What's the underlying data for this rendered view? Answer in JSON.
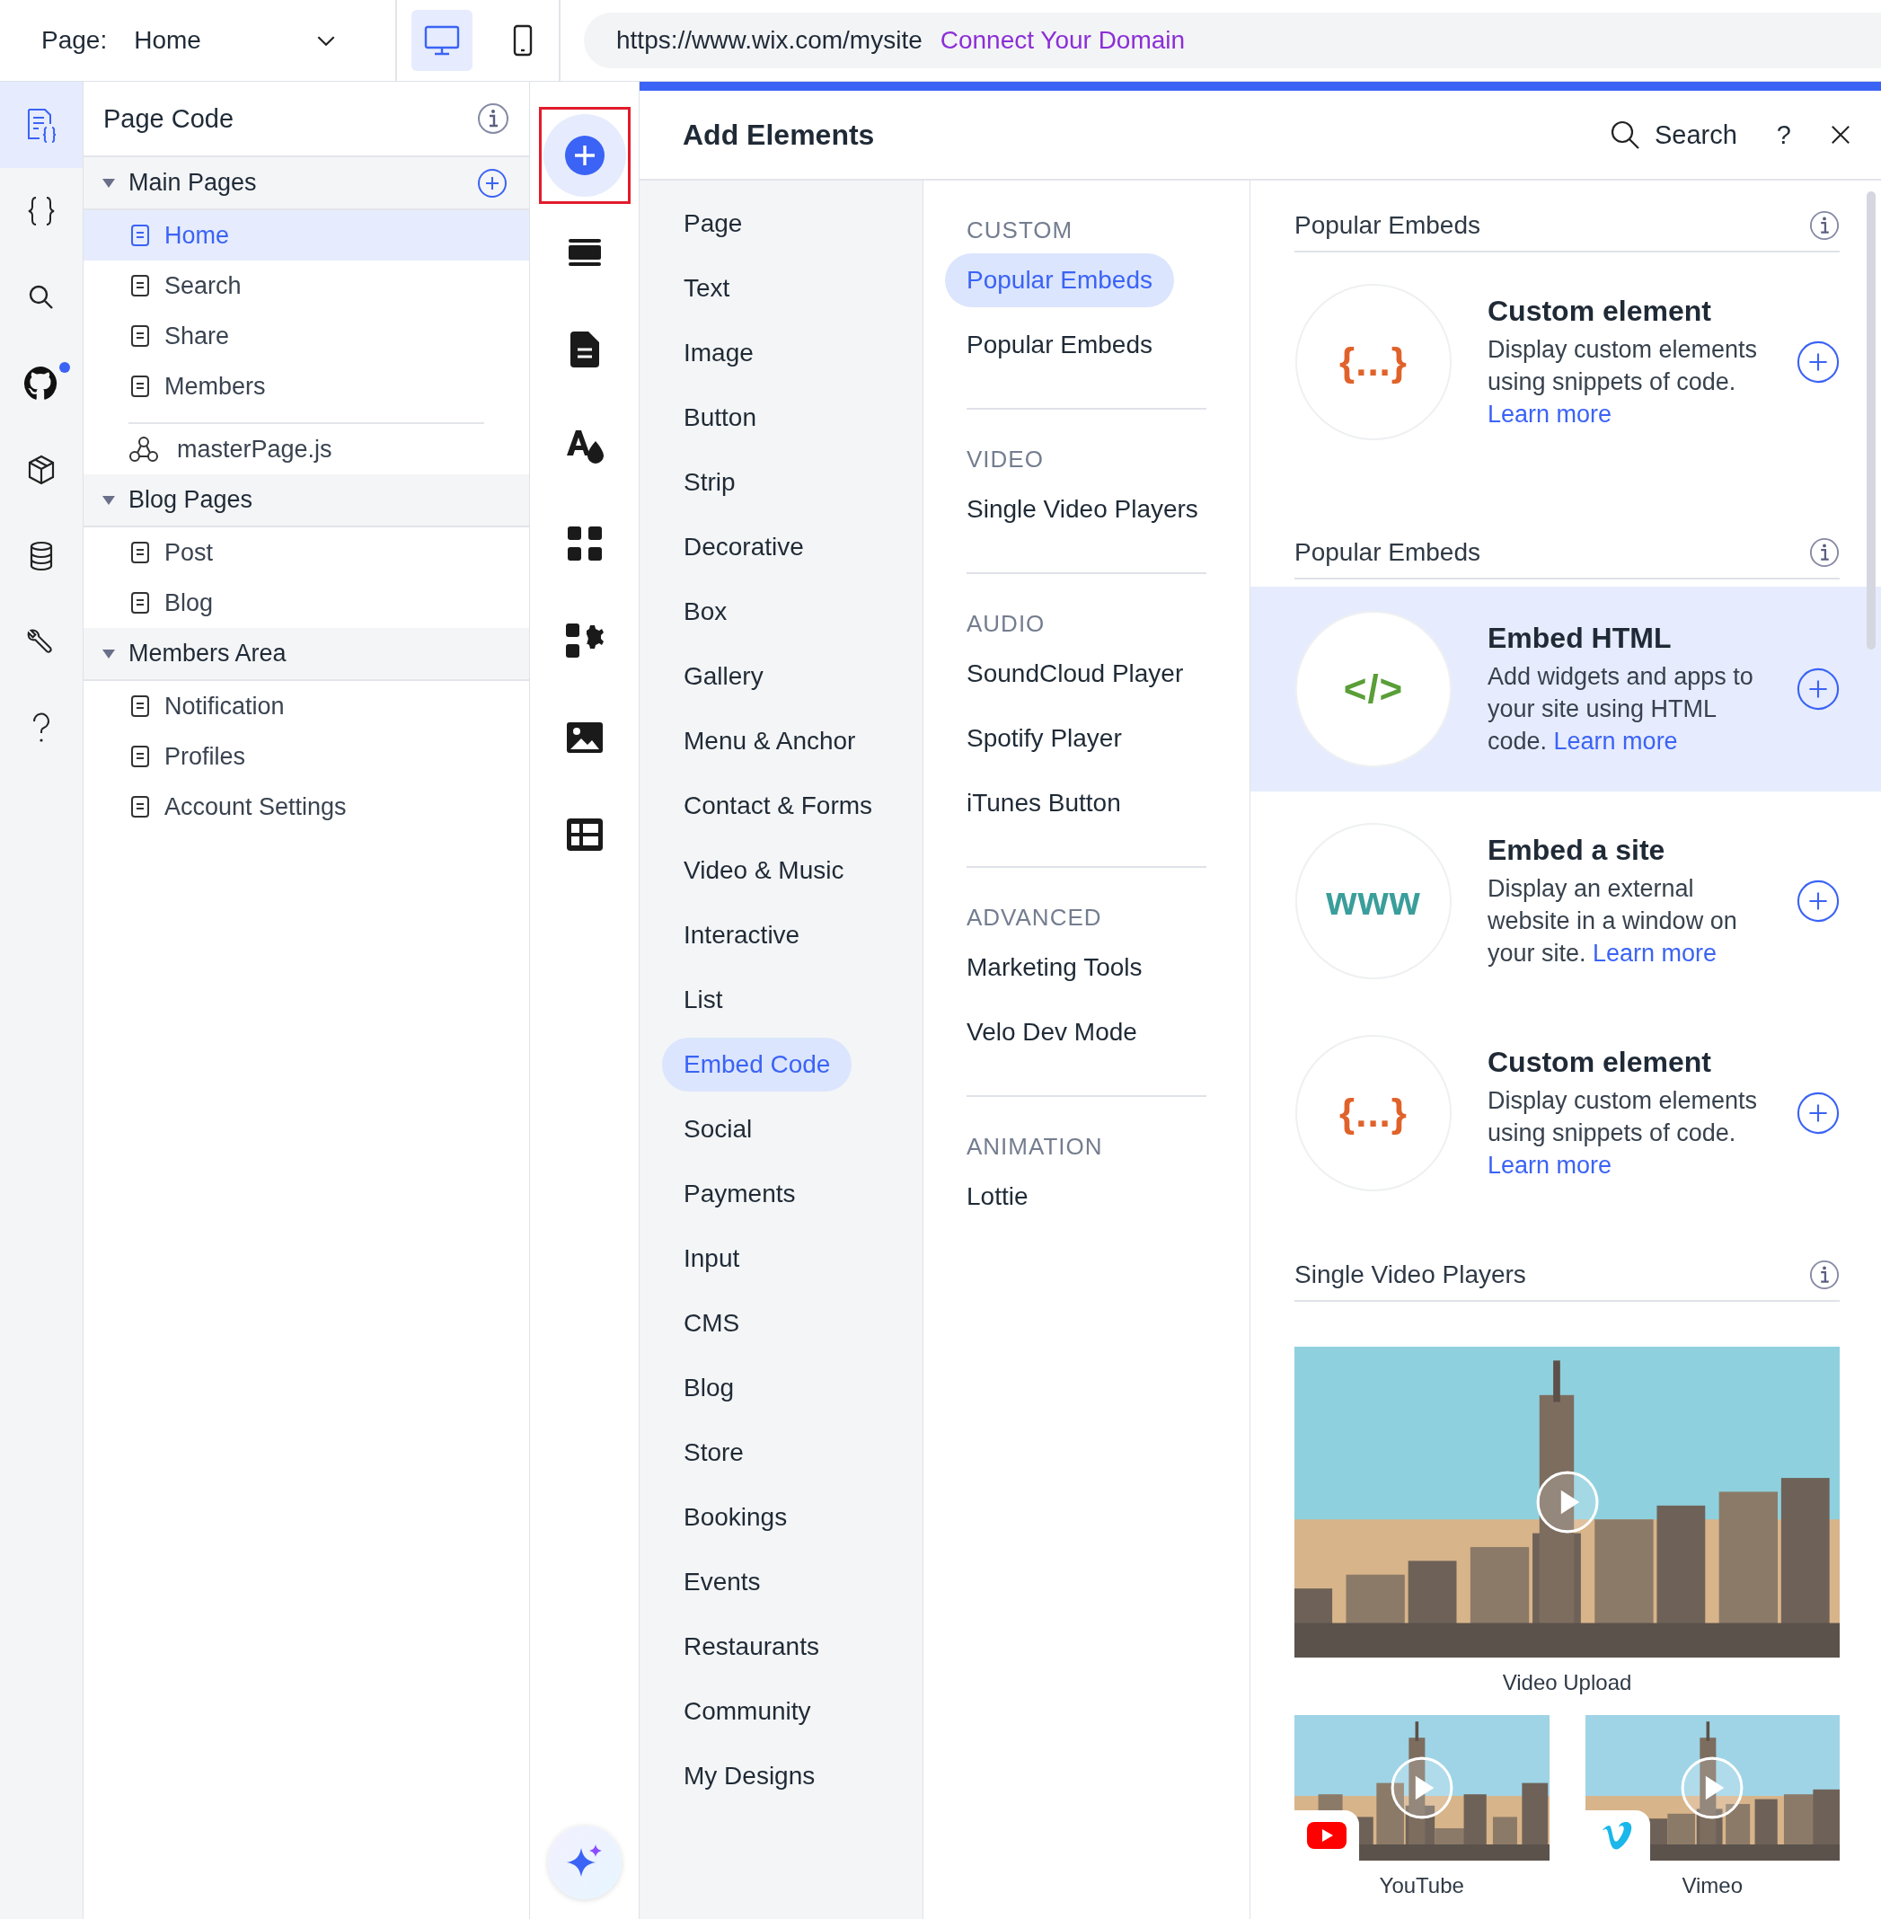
{
  "top_bar": {
    "page_label": "Page:",
    "page_value": "Home",
    "views": [
      {
        "kind": "desktop",
        "selected": true
      },
      {
        "kind": "mobile",
        "selected": false
      }
    ],
    "url": "https://www.wix.com/mysite",
    "domain_link": "Connect Your Domain"
  },
  "icon_rail": [
    {
      "kind": "page-code",
      "selected": true,
      "badge": false
    },
    {
      "kind": "braces",
      "selected": false,
      "badge": false
    },
    {
      "kind": "search",
      "selected": false,
      "badge": false
    },
    {
      "kind": "cat",
      "selected": false,
      "badge": true
    },
    {
      "kind": "cube",
      "selected": false,
      "badge": false
    },
    {
      "kind": "database",
      "selected": false,
      "badge": false
    },
    {
      "kind": "wrench",
      "selected": false,
      "badge": false
    },
    {
      "kind": "help",
      "selected": false,
      "badge": false
    }
  ],
  "page_code": {
    "title": "Page Code",
    "groups": [
      {
        "label": "Main Pages",
        "expanded": true,
        "add_button": true,
        "children": [
          {
            "label": "Home",
            "kind": "page",
            "selected": true
          },
          {
            "label": "Search",
            "kind": "page",
            "selected": false
          },
          {
            "label": "Share",
            "kind": "page",
            "selected": false
          },
          {
            "label": "Members",
            "kind": "page",
            "selected": false
          },
          {
            "label": "masterPage.js",
            "kind": "master",
            "selected": false
          }
        ]
      },
      {
        "label": "Blog Pages",
        "expanded": true,
        "add_button": false,
        "children": [
          {
            "label": "Post",
            "kind": "page",
            "selected": false
          },
          {
            "label": "Blog",
            "kind": "page",
            "selected": false
          }
        ]
      },
      {
        "label": "Members Area",
        "expanded": true,
        "add_button": false,
        "children": [
          {
            "label": "Notification",
            "kind": "page",
            "selected": false
          },
          {
            "label": "Profiles",
            "kind": "page",
            "selected": false
          },
          {
            "label": "Account Settings",
            "kind": "page",
            "selected": false
          }
        ]
      }
    ]
  },
  "tool_rail": [
    {
      "kind": "add",
      "selected": true
    },
    {
      "kind": "strip",
      "selected": false
    },
    {
      "kind": "document",
      "selected": false
    },
    {
      "kind": "theme",
      "selected": false
    },
    {
      "kind": "apps",
      "selected": false
    },
    {
      "kind": "app-settings",
      "selected": false
    },
    {
      "kind": "media",
      "selected": false
    },
    {
      "kind": "table",
      "selected": false
    }
  ],
  "add_panel": {
    "title": "Add Elements",
    "search": "Search",
    "help": "?",
    "categories": [
      {
        "label": "Page",
        "selected": false
      },
      {
        "label": "Text",
        "selected": false
      },
      {
        "label": "Image",
        "selected": false
      },
      {
        "label": "Button",
        "selected": false
      },
      {
        "label": "Strip",
        "selected": false
      },
      {
        "label": "Decorative",
        "selected": false
      },
      {
        "label": "Box",
        "selected": false
      },
      {
        "label": "Gallery",
        "selected": false
      },
      {
        "label": "Menu & Anchor",
        "selected": false
      },
      {
        "label": "Contact & Forms",
        "selected": false
      },
      {
        "label": "Video & Music",
        "selected": false
      },
      {
        "label": "Interactive",
        "selected": false
      },
      {
        "label": "List",
        "selected": false
      },
      {
        "label": "Embed Code",
        "selected": true
      },
      {
        "label": "Social",
        "selected": false
      },
      {
        "label": "Payments",
        "selected": false
      },
      {
        "label": "Input",
        "selected": false
      },
      {
        "label": "CMS",
        "selected": false
      },
      {
        "label": "Blog",
        "selected": false
      },
      {
        "label": "Store",
        "selected": false
      },
      {
        "label": "Bookings",
        "selected": false
      },
      {
        "label": "Events",
        "selected": false
      },
      {
        "label": "Restaurants",
        "selected": false
      },
      {
        "label": "Community",
        "selected": false
      },
      {
        "label": "My Designs",
        "selected": false
      }
    ],
    "sections": [
      {
        "heading": "CUSTOM",
        "items": [
          {
            "label": "Popular Embeds",
            "selected": true
          },
          {
            "label": "Popular Embeds",
            "selected": false
          }
        ]
      },
      {
        "heading": "VIDEO",
        "items": [
          {
            "label": "Single Video Players",
            "selected": false
          }
        ]
      },
      {
        "heading": "AUDIO",
        "items": [
          {
            "label": "SoundCloud Player",
            "selected": false
          },
          {
            "label": "Spotify Player",
            "selected": false
          },
          {
            "label": "iTunes Button",
            "selected": false
          }
        ]
      },
      {
        "heading": "ADVANCED",
        "items": [
          {
            "label": "Marketing Tools",
            "selected": false
          },
          {
            "label": "Velo Dev Mode",
            "selected": false
          }
        ]
      },
      {
        "heading": "ANIMATION",
        "items": [
          {
            "label": "Lottie",
            "selected": false
          }
        ]
      }
    ],
    "content": [
      {
        "heading": "Popular Embeds",
        "cards": [
          {
            "kind": "braces",
            "icon_text": "{...}",
            "title": "Custom element",
            "description": "Display custom elements using snippets of code.",
            "link": "Learn more",
            "selected": false
          }
        ]
      },
      {
        "heading": "Popular Embeds",
        "cards": [
          {
            "kind": "code",
            "icon_text": "</>",
            "title": "Embed HTML",
            "description": "Add widgets and apps to your site using HTML code.",
            "link": "Learn more",
            "selected": true
          },
          {
            "kind": "www",
            "icon_text": "www",
            "title": "Embed a site",
            "description": "Display an external website in a window on your site.",
            "link": "Learn more",
            "selected": false
          },
          {
            "kind": "braces",
            "icon_text": "{...}",
            "title": "Custom element",
            "description": "Display custom elements using snippets of code.",
            "link": "Learn more",
            "selected": false
          }
        ]
      },
      {
        "heading": "Single Video Players",
        "videos": [
          {
            "kind": "upload",
            "caption": "Video Upload"
          },
          {
            "kind": "youtube",
            "caption": "YouTube"
          },
          {
            "kind": "vimeo",
            "caption": "Vimeo"
          }
        ]
      }
    ]
  }
}
